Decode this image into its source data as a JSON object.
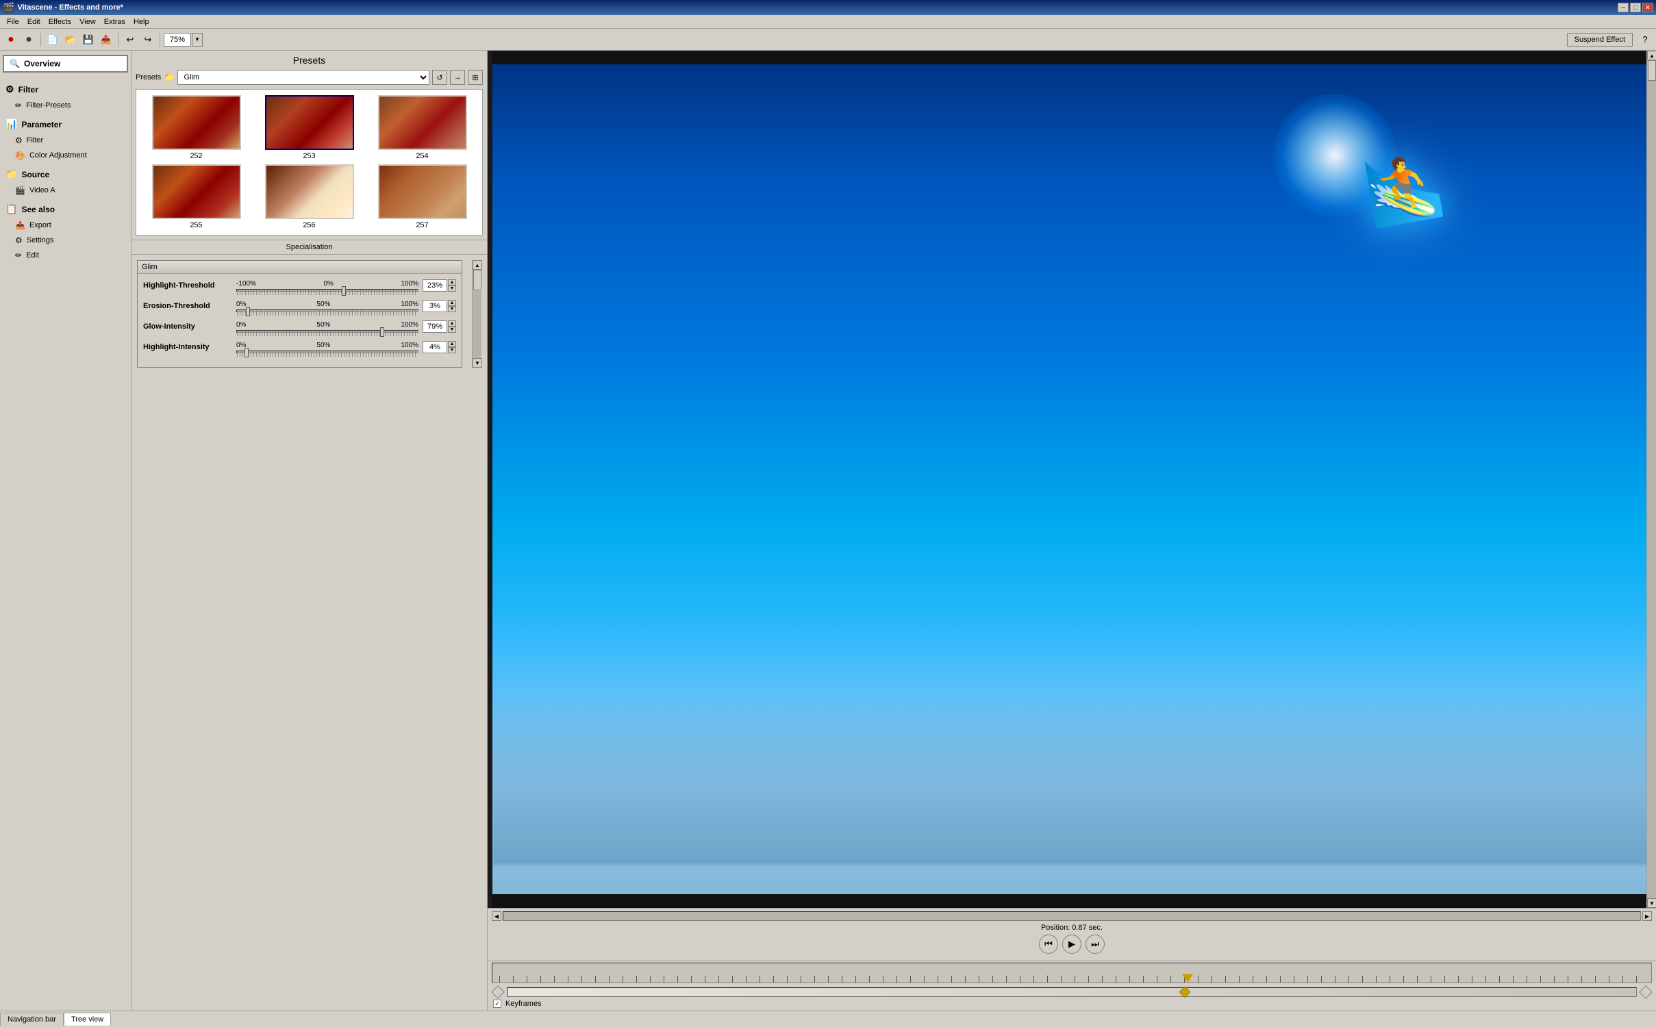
{
  "window": {
    "title": "Vitascene - Effects and more*",
    "icon": "🎬"
  },
  "titlebar_controls": {
    "minimize": "─",
    "maximize": "□",
    "close": "✕"
  },
  "menu": {
    "items": [
      "File",
      "Edit",
      "Effects",
      "View",
      "Extras",
      "Help"
    ]
  },
  "toolbar": {
    "zoom_value": "75%",
    "suspend_label": "Suspend Effect"
  },
  "sidebar": {
    "overview_label": "Overview",
    "sections": [
      {
        "id": "filter",
        "icon": "⚙",
        "label": "Filter",
        "items": [
          {
            "id": "filter-presets",
            "icon": "✏",
            "label": "Filter-Presets"
          }
        ]
      },
      {
        "id": "parameter",
        "icon": "📊",
        "label": "Parameter",
        "items": [
          {
            "id": "filter-item",
            "icon": "⚙",
            "label": "Filter"
          },
          {
            "id": "color-adjustment",
            "icon": "🎨",
            "label": "Color Adjustment"
          }
        ]
      },
      {
        "id": "source",
        "icon": "📁",
        "label": "Source",
        "items": [
          {
            "id": "video-a",
            "icon": "🎬",
            "label": "Video A"
          }
        ]
      },
      {
        "id": "see-also",
        "icon": "📋",
        "label": "See also",
        "items": [
          {
            "id": "export",
            "icon": "📤",
            "label": "Export"
          },
          {
            "id": "settings",
            "icon": "⚙",
            "label": "Settings"
          },
          {
            "id": "edit",
            "icon": "✏",
            "label": "Edit"
          }
        ]
      }
    ]
  },
  "presets": {
    "title": "Presets",
    "label": "Presets",
    "selected_folder": "Glim",
    "items": [
      {
        "num": "252",
        "selected": false
      },
      {
        "num": "253",
        "selected": true
      },
      {
        "num": "254",
        "selected": false
      },
      {
        "num": "255",
        "selected": false
      },
      {
        "num": "256",
        "selected": false
      },
      {
        "num": "257",
        "selected": false
      }
    ]
  },
  "specialisation": {
    "title": "Specialisation",
    "section_title": "Glim",
    "params": [
      {
        "id": "highlight-threshold",
        "label": "Highlight-Threshold",
        "min": "-100%",
        "mid": "0%",
        "max": "100%",
        "value": "23%",
        "thumb_pos": "58"
      },
      {
        "id": "erosion-threshold",
        "label": "Erosion-Threshold",
        "min": "0%",
        "mid": "50%",
        "max": "100%",
        "value": "3%",
        "thumb_pos": "5"
      },
      {
        "id": "glow-intensity",
        "label": "Glow-Intensity",
        "min": "0%",
        "mid": "50%",
        "max": "100%",
        "value": "79%",
        "thumb_pos": "79"
      },
      {
        "id": "highlight-intensity",
        "label": "Highlight-Intensity",
        "min": "0%",
        "mid": "50%",
        "max": "100%",
        "value": "4%",
        "thumb_pos": "4"
      }
    ]
  },
  "preview": {
    "position_label": "Position: 0.87 sec."
  },
  "timeline": {
    "keyframes_label": "Keyframes",
    "keyframes_checked": true
  },
  "nav": {
    "tabs": [
      "Navigation bar",
      "Tree view"
    ],
    "active": "Tree view"
  }
}
